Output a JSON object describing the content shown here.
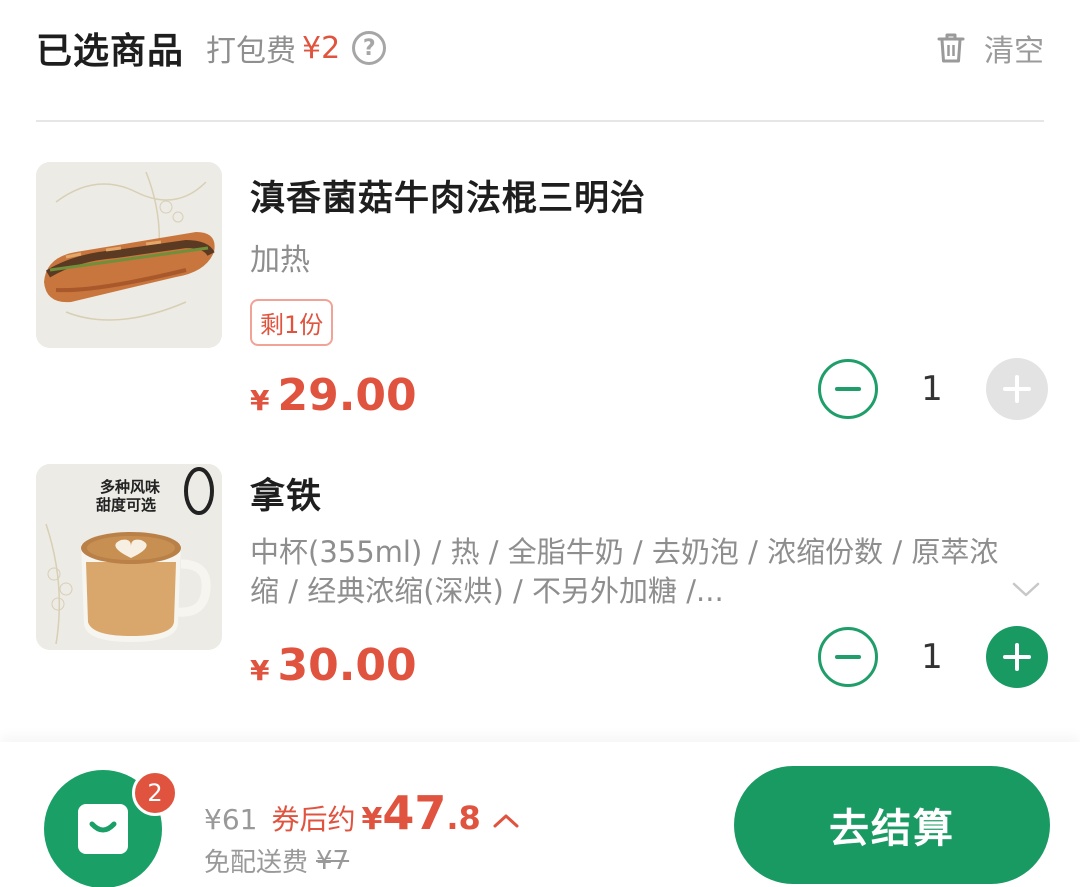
{
  "header": {
    "title": "已选商品",
    "pack_label": "打包费",
    "pack_price": "¥2",
    "help_glyph": "?",
    "clear_label": "清空"
  },
  "items": [
    {
      "name": "滇香菌菇牛肉法棍三明治",
      "spec": "加热",
      "badge": "剩1份",
      "currency": "¥",
      "price": "29.00",
      "quantity": "1",
      "plus_enabled": false
    },
    {
      "name": "拿铁",
      "promo_line1": "多种风味",
      "promo_line2": "甜度可选",
      "spec": "中杯(355ml) / 热 / 全脂牛奶 / 去奶泡 / 浓缩份数 / 原萃浓缩 / 经典浓缩(深烘) / 不另外加糖 /...",
      "currency": "¥",
      "price": "30.00",
      "quantity": "1",
      "plus_enabled": true
    }
  ],
  "footer": {
    "cart_count": "2",
    "original_total": "¥61",
    "after_coupon_label": "券后约",
    "total_currency": "¥",
    "total_integer": "47",
    "total_decimal": ".8",
    "delivery_label": "免配送费",
    "delivery_fee": "¥7",
    "checkout_label": "去结算"
  },
  "colors": {
    "brand_green": "#1a9a63",
    "price_red": "#e0533f",
    "muted_gray": "#8e8e8e"
  },
  "icons": [
    "trash-icon",
    "help-icon",
    "minus-icon",
    "plus-icon",
    "chevron-down-icon",
    "shopping-bag-icon",
    "caret-up-icon"
  ]
}
